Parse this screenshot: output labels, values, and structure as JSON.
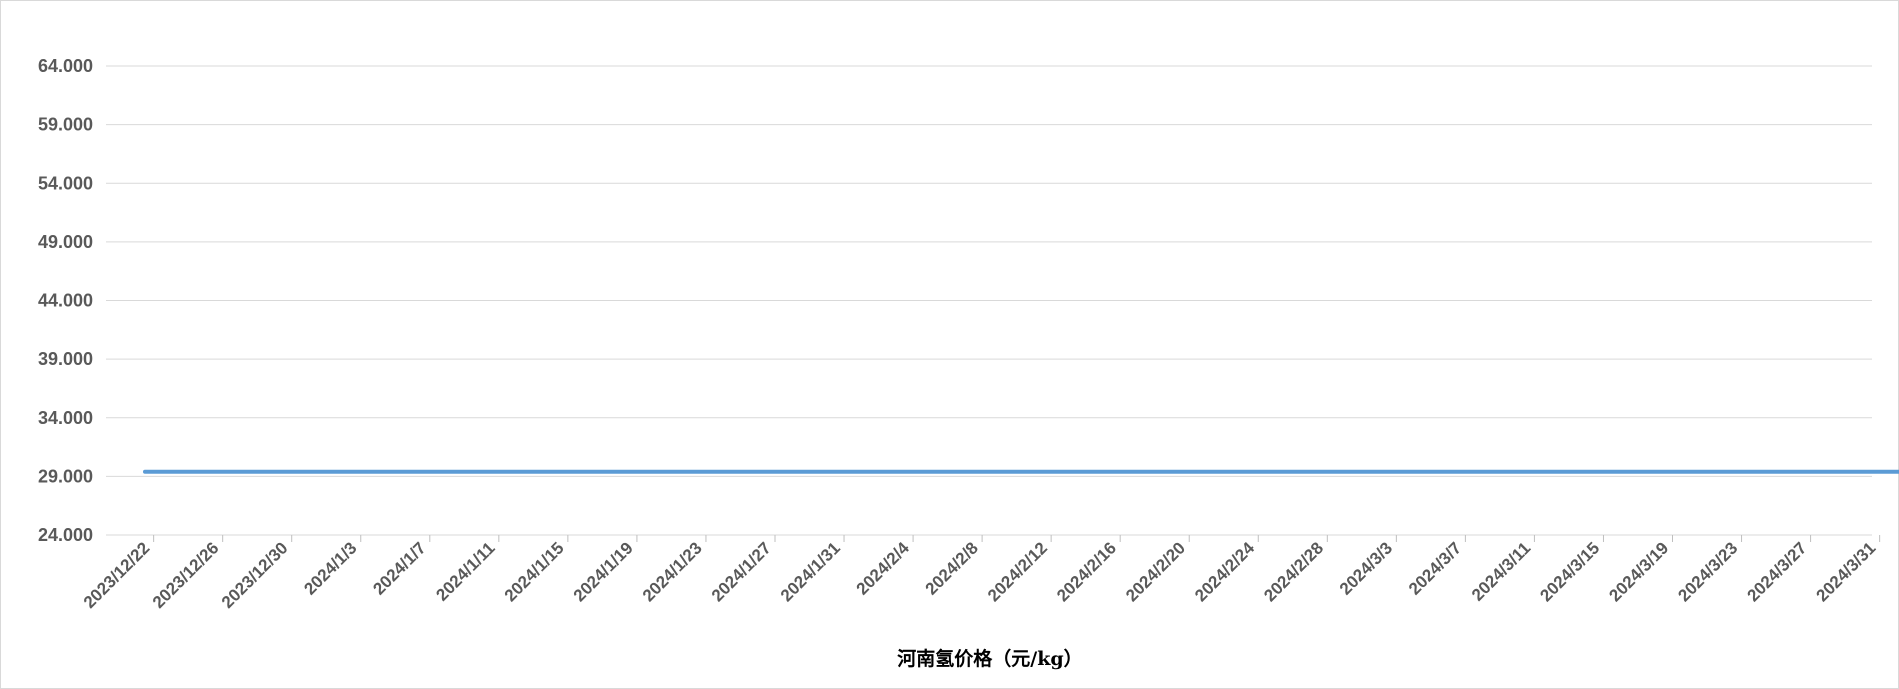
{
  "chart_data": {
    "type": "line",
    "title": "",
    "xlabel": "河南氢价格（元/kg）",
    "ylabel": "",
    "ylim": [
      24,
      64
    ],
    "yticks": [
      "24.000",
      "29.000",
      "34.000",
      "39.000",
      "44.000",
      "49.000",
      "54.000",
      "59.000",
      "64.000"
    ],
    "x_start": "2023/12/22",
    "x_end": "2024/4/2",
    "xticks": [
      "2023/12/22",
      "2023/12/26",
      "2023/12/30",
      "2024/1/3",
      "2024/1/7",
      "2024/1/11",
      "2024/1/15",
      "2024/1/19",
      "2024/1/23",
      "2024/1/27",
      "2024/1/31",
      "2024/2/4",
      "2024/2/8",
      "2024/2/12",
      "2024/2/16",
      "2024/2/20",
      "2024/2/24",
      "2024/2/28",
      "2024/3/3",
      "2024/3/7",
      "2024/3/11",
      "2024/3/15",
      "2024/3/19",
      "2024/3/23",
      "2024/3/27",
      "2024/3/31"
    ],
    "grid": true,
    "legend": "none",
    "series": [
      {
        "color": "#5b9bd5",
        "points": [
          {
            "x": "2023/12/22",
            "y": 29.4
          },
          {
            "x": "2024/4/2",
            "y": 29.4
          }
        ]
      }
    ]
  }
}
